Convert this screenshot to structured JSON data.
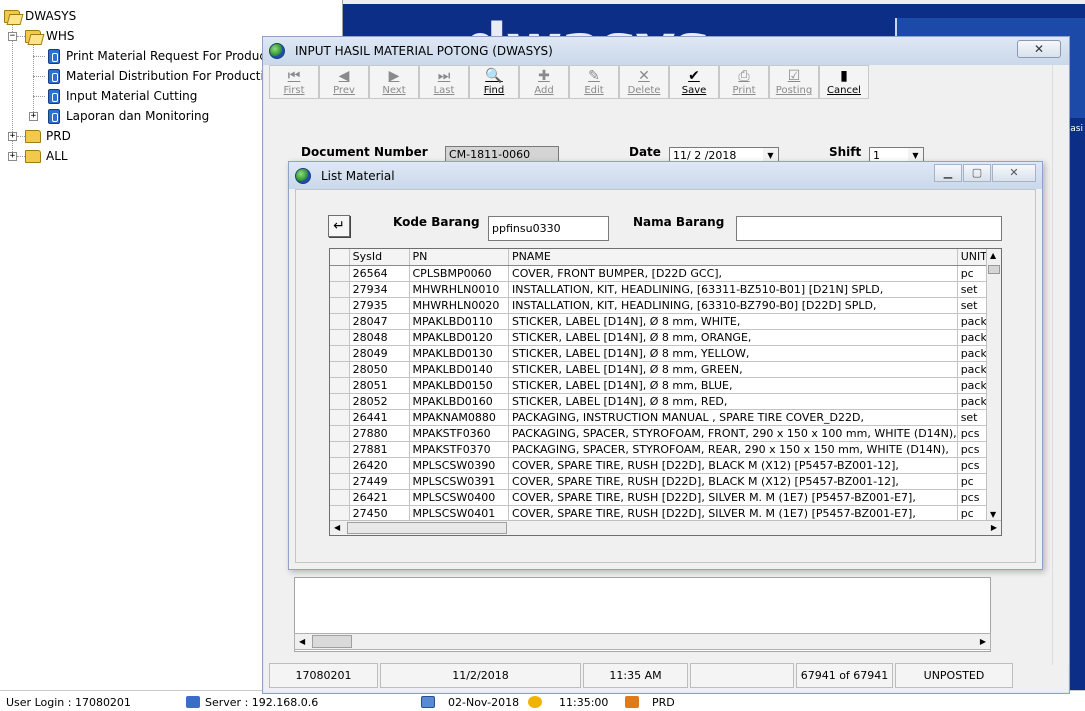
{
  "tree": {
    "root": "DWASYS",
    "whs": "WHS",
    "items": [
      "Print Material Request For Product",
      "Material Distribution For Production",
      "Input Material Cutting",
      "Laporan dan Monitoring"
    ],
    "prd": "PRD",
    "all": "ALL"
  },
  "bottom_status": {
    "user_login": "User Login : 17080201",
    "server": "Server : 192.168.0.6",
    "date": "02-Nov-2018",
    "time": "11:35:00",
    "db": "PRD"
  },
  "background_logo": {
    "text": "dwasys",
    "small": "dwa",
    "side_text": "asi"
  },
  "main_window": {
    "title": "INPUT HASIL MATERIAL POTONG (DWASYS)",
    "close_glyph": "✕",
    "toolbar": [
      {
        "label": "First",
        "glyph": "⏮",
        "active": false
      },
      {
        "label": "Prev",
        "glyph": "◀",
        "active": false
      },
      {
        "label": "Next",
        "glyph": "▶",
        "active": false
      },
      {
        "label": "Last",
        "glyph": "⏭",
        "active": false
      },
      {
        "label": "Find",
        "glyph": "🔍",
        "active": true
      },
      {
        "label": "Add",
        "glyph": "✚",
        "active": false
      },
      {
        "label": "Edit",
        "glyph": "✎",
        "active": false
      },
      {
        "label": "Delete",
        "glyph": "✕",
        "active": false
      },
      {
        "label": "Save",
        "glyph": "✔",
        "active": true
      },
      {
        "label": "Print",
        "glyph": "⎙",
        "active": false
      },
      {
        "label": "Posting",
        "glyph": "☑",
        "active": false
      },
      {
        "label": "Cancel",
        "glyph": "▮",
        "active": true
      }
    ],
    "document_number_label": "Document Number",
    "document_number": "CM-1811-0060",
    "date_label": "Date",
    "date": "11/ 2 /2018",
    "shift_label": "Shift",
    "shift": "1",
    "status_bar": {
      "user": "17080201",
      "date": "11/2/2018",
      "time": "11:35 AM",
      "blank": "",
      "record": "67941 of 67941",
      "status": "UNPOSTED"
    }
  },
  "list_dialog": {
    "title": "List Material",
    "back_glyph": "↵",
    "kode_label": "Kode Barang",
    "kode_value": "ppfinsu0330",
    "nama_label": "Nama Barang",
    "nama_value": "",
    "columns": [
      "SysId",
      "PN",
      "PNAME",
      "UNIT"
    ],
    "rows": [
      [
        "26564",
        "CPLSBMP0060",
        "COVER, FRONT BUMPER, [D22D GCC],",
        "pc"
      ],
      [
        "27934",
        "MHWRHLN0010",
        "INSTALLATION, KIT, HEADLINING,  [63311-BZ510-B01] [D21N] SPLD,",
        "set"
      ],
      [
        "27935",
        "MHWRHLN0020",
        "INSTALLATION, KIT, HEADLINING,  [63310-BZ790-B0] [D22D] SPLD,",
        "set"
      ],
      [
        "28047",
        "MPAKLBD0110",
        "STICKER,    LABEL [D14N], Ø 8 mm, WHITE,",
        "pack"
      ],
      [
        "28048",
        "MPAKLBD0120",
        "STICKER,    LABEL [D14N], Ø 8 mm, ORANGE,",
        "pack"
      ],
      [
        "28049",
        "MPAKLBD0130",
        "STICKER,    LABEL [D14N], Ø 8 mm, YELLOW,",
        "pack"
      ],
      [
        "28050",
        "MPAKLBD0140",
        "STICKER,    LABEL [D14N], Ø 8 mm, GREEN,",
        "pack"
      ],
      [
        "28051",
        "MPAKLBD0150",
        "STICKER,    LABEL [D14N], Ø 8 mm, BLUE,",
        "pack"
      ],
      [
        "28052",
        "MPAKLBD0160",
        "STICKER,    LABEL [D14N], Ø 8 mm, RED,",
        "pack"
      ],
      [
        "26441",
        "MPAKNAM0880",
        "PACKAGING, INSTRUCTION MANUAL ,   SPARE TIRE COVER_D22D,",
        "set"
      ],
      [
        "27880",
        "MPAKSTF0360",
        "PACKAGING, SPACER, STYROFOAM, FRONT,  290 x 150 x 100 mm, WHITE (D14N),",
        "pcs"
      ],
      [
        "27881",
        "MPAKSTF0370",
        "PACKAGING, SPACER, STYROFOAM, REAR,  290 x 150 x 150 mm, WHITE (D14N),",
        "pcs"
      ],
      [
        "26420",
        "MPLSCSW0390",
        "COVER, SPARE TIRE, RUSH [D22D], BLACK M (X12) [P5457-BZ001-12],",
        "pcs"
      ],
      [
        "27449",
        "MPLSCSW0391",
        "COVER, SPARE TIRE, RUSH [D22D],  BLACK M (X12) [P5457-BZ001-12],",
        "pc"
      ],
      [
        "26421",
        "MPLSCSW0400",
        "COVER, SPARE TIRE, RUSH [D22D], SILVER M. M (1E7) [P5457-BZ001-E7],",
        "pcs"
      ],
      [
        "27450",
        "MPLSCSW0401",
        "COVER, SPARE TIRE, RUSH [D22D],  SILVER M. M (1E7) [P5457-BZ001-E7],",
        "pc"
      ]
    ]
  }
}
